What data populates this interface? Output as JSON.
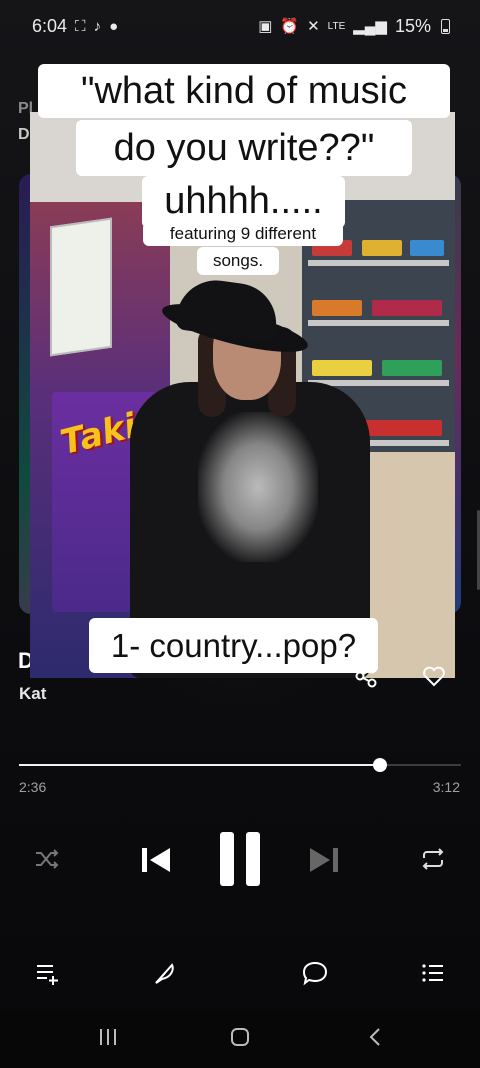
{
  "status_bar": {
    "time": "6:04",
    "network": "LTE",
    "battery": "15%"
  },
  "background_app": {
    "playing_label": "Pl",
    "source_label": "D",
    "song_title": "D",
    "artist": "Kat"
  },
  "video_captions": {
    "line1": "\"what kind of music",
    "line2": "do you write??\"",
    "line3": "uhhhh.....",
    "line4": "featuring 9 different",
    "line5": "songs.",
    "line6": "1- country...pop?"
  },
  "video_scene": {
    "snack_brand": "Takis"
  },
  "player": {
    "progress_fraction": 0.816,
    "elapsed": "2:36",
    "total": "3:12"
  },
  "colors": {
    "accent": "#ffffff",
    "muted": "#a0a0a4",
    "background": "#0b0b0d"
  },
  "icons": {
    "status": [
      "screenshot-icon",
      "tiktok-icon",
      "chat-icon",
      "battery-saver-icon",
      "alarm-icon",
      "mute-icon",
      "signal-icon"
    ],
    "controls": [
      "shuffle-icon",
      "previous-icon",
      "pause-icon",
      "next-icon",
      "repeat-icon"
    ],
    "bottom": [
      "queue-add-icon",
      "lyrics-feather-icon",
      "comment-icon",
      "menu-list-icon"
    ],
    "nav": [
      "recent-apps-icon",
      "home-icon",
      "back-icon"
    ]
  }
}
